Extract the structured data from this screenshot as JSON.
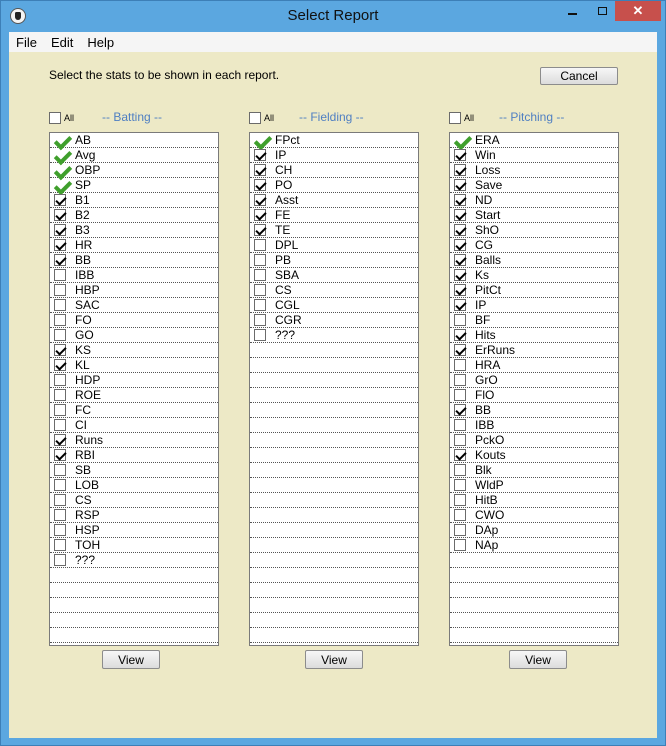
{
  "window": {
    "title": "Select Report"
  },
  "menu": [
    {
      "label": "File"
    },
    {
      "label": "Edit"
    },
    {
      "label": "Help"
    }
  ],
  "instructions": "Select the stats to be shown in each report.",
  "cancel_label": "Cancel",
  "view_label": "View",
  "all_label": "All",
  "sections": [
    {
      "id": "batting",
      "title": "-- Batting --",
      "items": [
        {
          "label": "AB",
          "state": "default"
        },
        {
          "label": "Avg",
          "state": "default"
        },
        {
          "label": "OBP",
          "state": "default"
        },
        {
          "label": "SP",
          "state": "default"
        },
        {
          "label": "B1",
          "state": "checked"
        },
        {
          "label": "B2",
          "state": "checked"
        },
        {
          "label": "B3",
          "state": "checked"
        },
        {
          "label": "HR",
          "state": "checked"
        },
        {
          "label": "BB",
          "state": "checked"
        },
        {
          "label": "IBB",
          "state": "unchecked"
        },
        {
          "label": "HBP",
          "state": "unchecked"
        },
        {
          "label": "SAC",
          "state": "unchecked"
        },
        {
          "label": "FO",
          "state": "unchecked"
        },
        {
          "label": "GO",
          "state": "unchecked"
        },
        {
          "label": "KS",
          "state": "checked"
        },
        {
          "label": "KL",
          "state": "checked"
        },
        {
          "label": "HDP",
          "state": "unchecked"
        },
        {
          "label": "ROE",
          "state": "unchecked"
        },
        {
          "label": "FC",
          "state": "unchecked"
        },
        {
          "label": "CI",
          "state": "unchecked"
        },
        {
          "label": "Runs",
          "state": "checked"
        },
        {
          "label": "RBI",
          "state": "checked"
        },
        {
          "label": "SB",
          "state": "unchecked"
        },
        {
          "label": "LOB",
          "state": "unchecked"
        },
        {
          "label": "CS",
          "state": "unchecked"
        },
        {
          "label": "RSP",
          "state": "unchecked"
        },
        {
          "label": "HSP",
          "state": "unchecked"
        },
        {
          "label": "TOH",
          "state": "unchecked"
        },
        {
          "label": "???",
          "state": "unchecked"
        }
      ]
    },
    {
      "id": "fielding",
      "title": "-- Fielding --",
      "items": [
        {
          "label": "FPct",
          "state": "default"
        },
        {
          "label": "IP",
          "state": "checked"
        },
        {
          "label": "CH",
          "state": "checked"
        },
        {
          "label": "PO",
          "state": "checked"
        },
        {
          "label": "Asst",
          "state": "checked"
        },
        {
          "label": "FE",
          "state": "checked"
        },
        {
          "label": "TE",
          "state": "checked"
        },
        {
          "label": "DPL",
          "state": "unchecked"
        },
        {
          "label": "PB",
          "state": "unchecked"
        },
        {
          "label": "SBA",
          "state": "unchecked"
        },
        {
          "label": "CS",
          "state": "unchecked"
        },
        {
          "label": "CGL",
          "state": "unchecked"
        },
        {
          "label": "CGR",
          "state": "unchecked"
        },
        {
          "label": "???",
          "state": "unchecked"
        }
      ]
    },
    {
      "id": "pitching",
      "title": "-- Pitching --",
      "items": [
        {
          "label": "ERA",
          "state": "default"
        },
        {
          "label": "Win",
          "state": "checked"
        },
        {
          "label": "Loss",
          "state": "checked"
        },
        {
          "label": "Save",
          "state": "checked"
        },
        {
          "label": "ND",
          "state": "checked"
        },
        {
          "label": "Start",
          "state": "checked"
        },
        {
          "label": "ShO",
          "state": "checked"
        },
        {
          "label": "CG",
          "state": "checked"
        },
        {
          "label": "Balls",
          "state": "checked"
        },
        {
          "label": "Ks",
          "state": "checked"
        },
        {
          "label": "PitCt",
          "state": "checked"
        },
        {
          "label": "IP",
          "state": "checked"
        },
        {
          "label": "BF",
          "state": "unchecked"
        },
        {
          "label": "Hits",
          "state": "checked"
        },
        {
          "label": "ErRuns",
          "state": "checked"
        },
        {
          "label": "HRA",
          "state": "unchecked"
        },
        {
          "label": "GrO",
          "state": "unchecked"
        },
        {
          "label": "FlO",
          "state": "unchecked"
        },
        {
          "label": "BB",
          "state": "checked"
        },
        {
          "label": "IBB",
          "state": "unchecked"
        },
        {
          "label": "PckO",
          "state": "unchecked"
        },
        {
          "label": "Kouts",
          "state": "checked"
        },
        {
          "label": "Blk",
          "state": "unchecked"
        },
        {
          "label": "WldP",
          "state": "unchecked"
        },
        {
          "label": "HitB",
          "state": "unchecked"
        },
        {
          "label": "CWO",
          "state": "unchecked"
        },
        {
          "label": "DAp",
          "state": "unchecked"
        },
        {
          "label": "NAp",
          "state": "unchecked"
        }
      ]
    }
  ]
}
